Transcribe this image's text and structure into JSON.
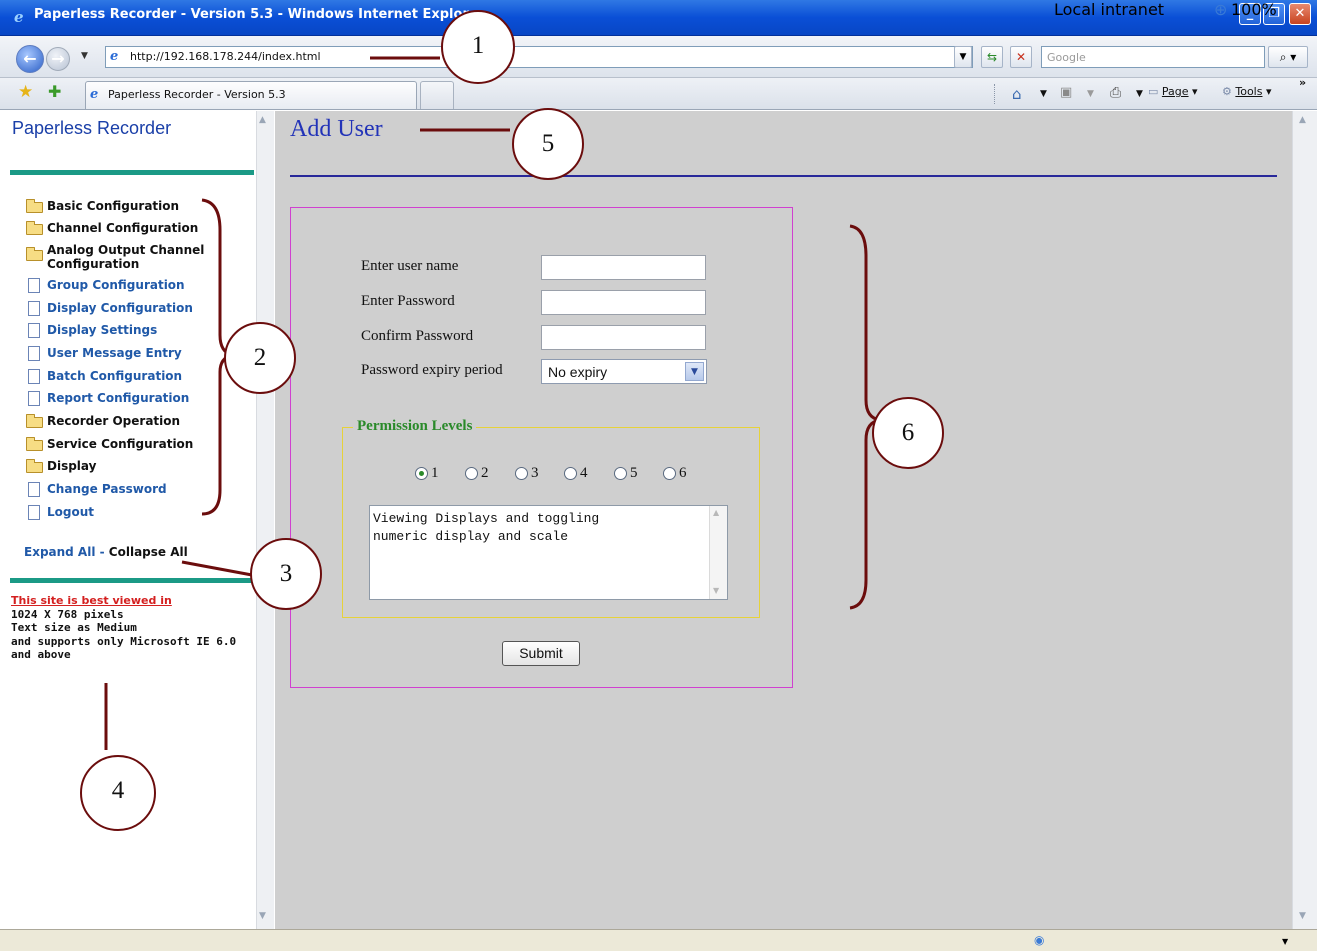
{
  "browser": {
    "window_title": "Paperless Recorder - Version 5.3 - Windows Internet Explorer",
    "window_title_visible": "Paperless Recorder - Version 5.3 - Windows Internet Explor",
    "address": "http://192.168.178.244/index.html",
    "search_placeholder": "Google",
    "tab_title": "Paperless Recorder - Version 5.3",
    "cmd_page": "Page",
    "cmd_tools": "Tools"
  },
  "sidebar": {
    "app_name": "Paperless Recorder",
    "items": [
      {
        "label": "Basic Configuration",
        "type": "folder"
      },
      {
        "label": "Channel Configuration",
        "type": "folder"
      },
      {
        "label": "Analog Output Channel Configuration",
        "type": "folder"
      },
      {
        "label": "Group Configuration",
        "type": "page"
      },
      {
        "label": "Display Configuration",
        "type": "page"
      },
      {
        "label": "Display Settings",
        "type": "page"
      },
      {
        "label": "User Message Entry",
        "type": "page"
      },
      {
        "label": "Batch Configuration",
        "type": "page"
      },
      {
        "label": "Report Configuration",
        "type": "page"
      },
      {
        "label": "Recorder Operation",
        "type": "folder"
      },
      {
        "label": "Service Configuration",
        "type": "folder"
      },
      {
        "label": "Display",
        "type": "folder"
      },
      {
        "label": "Change Password",
        "type": "page"
      },
      {
        "label": "Logout",
        "type": "page"
      }
    ],
    "expand_all": "Expand All",
    "expand_sep": " - ",
    "collapse_all": "Collapse All",
    "best_viewed": "This site is best viewed in",
    "best_viewed_lines": [
      "1024 X 768 pixels",
      "Text size as Medium",
      "and supports only Microsoft IE 6.0",
      "and above"
    ]
  },
  "main": {
    "title": "Add User",
    "form": {
      "user_name_label": "Enter user name",
      "user_name_value": "",
      "password_label": "Enter Password",
      "password_value": "",
      "confirm_label": "Confirm Password",
      "confirm_value": "",
      "expiry_label": "Password expiry period",
      "expiry_selected": "No expiry",
      "permission_legend": "Permission Levels",
      "permission_levels": [
        "1",
        "2",
        "3",
        "4",
        "5",
        "6"
      ],
      "permission_selected": "1",
      "permission_description": "Viewing Displays and toggling\nnumeric display and scale",
      "submit_label": "Submit"
    }
  },
  "status": {
    "zone": "Local intranet",
    "zoom": "100%"
  },
  "callouts": [
    "1",
    "2",
    "3",
    "4",
    "5",
    "6"
  ],
  "colors": {
    "title_blue": "#2233b8",
    "teal_bar": "#1b9a86",
    "form_border": "#d040d0",
    "perm_border": "#e6d23a",
    "legend_green": "#2a8a2a",
    "callout_stroke": "#6b0d0d"
  },
  "icons": [
    "ie-logo-icon",
    "back-icon",
    "forward-icon",
    "page-icon",
    "refresh-icon",
    "stop-icon",
    "search-icon",
    "favorites-icon",
    "home-icon",
    "feeds-icon",
    "print-icon",
    "tools-icon",
    "folder-icon",
    "document-icon",
    "globe-icon",
    "zoom-icon"
  ]
}
